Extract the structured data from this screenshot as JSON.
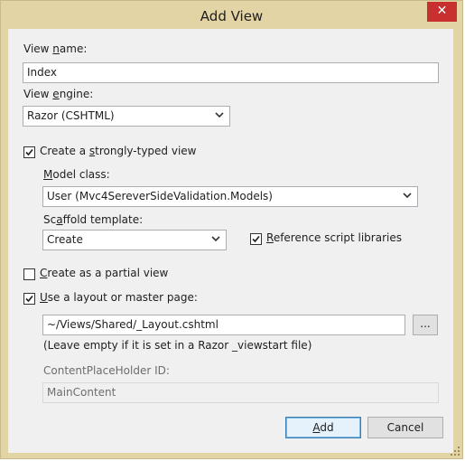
{
  "window": {
    "title": "Add View",
    "close_glyph": "✕"
  },
  "view_name": {
    "label_underlined": "n",
    "label_pre": "View ",
    "label_post": "ame:",
    "value": "Index"
  },
  "view_engine": {
    "label_pre": "View ",
    "label_underlined": "e",
    "label_post": "ngine:",
    "selected": "Razor (CSHTML)"
  },
  "strongly_typed": {
    "checked": true,
    "label_pre": "Create a ",
    "label_underlined": "s",
    "label_post": "trongly-typed view"
  },
  "model_class": {
    "label_pre": "",
    "label_underlined": "M",
    "label_post": "odel class:",
    "selected": "User (Mvc4SereverSideValidation.Models)"
  },
  "scaffold": {
    "label_pre": "Sc",
    "label_underlined": "a",
    "label_post": "ffold template:",
    "selected": "Create"
  },
  "reference_scripts": {
    "checked": true,
    "label_pre": "",
    "label_underlined": "R",
    "label_post": "eference script libraries"
  },
  "partial_view": {
    "checked": false,
    "label_pre": "",
    "label_underlined": "C",
    "label_post": "reate as a partial view"
  },
  "layout": {
    "checked": true,
    "label_pre": "",
    "label_underlined": "U",
    "label_post": "se a layout or master page:",
    "value": "~/Views/Shared/_Layout.cshtml",
    "browse_label": "...",
    "hint": "(Leave empty if it is set in a Razor _viewstart file)"
  },
  "content_placeholder": {
    "label": "ContentPlaceHolder ID:",
    "value": "MainContent"
  },
  "buttons": {
    "add_pre": "",
    "add_underlined": "A",
    "add_post": "dd",
    "cancel": "Cancel"
  },
  "icons": {
    "check": "checkmark-icon",
    "dropdown": "chevron-down-icon",
    "grip": "resize-grip-icon"
  }
}
